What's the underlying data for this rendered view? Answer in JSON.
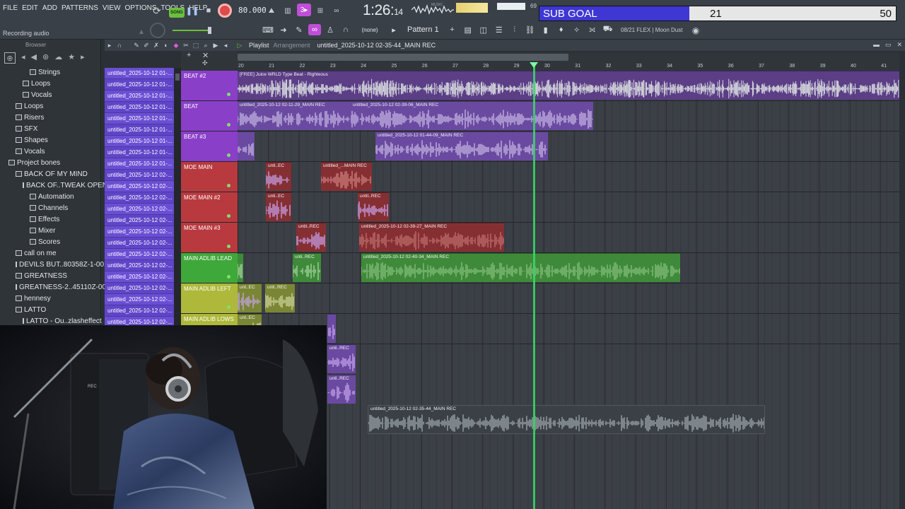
{
  "menu": [
    "FILE",
    "EDIT",
    "ADD",
    "PATTERNS",
    "VIEW",
    "OPTIONS",
    "TOOLS",
    "HELP"
  ],
  "transport": {
    "song_toggle": "SONG",
    "tempo": "80.000",
    "time_main": "1:26",
    "time_sub": "14"
  },
  "cpu_label": "MUSIC",
  "cpu_value": "69",
  "status": "Recording audio",
  "sub_goal": {
    "label": "SUB GOAL",
    "current": "21",
    "goal": "50",
    "progress": 0.42,
    "fill_color": "#3f37d3"
  },
  "toolbar2": {
    "snap": "(none)",
    "pattern": "Pattern 1",
    "hint": "08/21  FLEX | Moon Dust"
  },
  "browser": {
    "title": "Browser",
    "items": [
      {
        "label": "Strings",
        "indent": 3
      },
      {
        "label": "Loops",
        "indent": 2
      },
      {
        "label": "Vocals",
        "indent": 2
      },
      {
        "label": "Loops",
        "indent": 1
      },
      {
        "label": "Risers",
        "indent": 1
      },
      {
        "label": "SFX",
        "indent": 1
      },
      {
        "label": "Shapes",
        "indent": 1
      },
      {
        "label": "Vocals",
        "indent": 1
      },
      {
        "label": "Project bones",
        "indent": 0
      },
      {
        "label": "BACK OF MY MIND",
        "indent": 1
      },
      {
        "label": "BACK OF..TWEAK OPEN",
        "indent": 2
      },
      {
        "label": "Automation",
        "indent": 3
      },
      {
        "label": "Channels",
        "indent": 3
      },
      {
        "label": "Effects",
        "indent": 3
      },
      {
        "label": "Mixer",
        "indent": 3
      },
      {
        "label": "Scores",
        "indent": 3
      },
      {
        "label": "call on me",
        "indent": 1
      },
      {
        "label": "DEVILS BUT..80358Z-1-001",
        "indent": 1
      },
      {
        "label": "GREATNESS",
        "indent": 1
      },
      {
        "label": "GREATNESS-2..45110Z-001",
        "indent": 1
      },
      {
        "label": "hennesy",
        "indent": 1
      },
      {
        "label": "LATTO",
        "indent": 1
      },
      {
        "label": "LATTO - Ou..zlasheffect",
        "indent": 2
      }
    ]
  },
  "channels": [
    "untitled_2025-10-12 01-...",
    "untitled_2025-10-12 01-...",
    "untitled_2025-10-12 01-...",
    "untitled_2025-10-12 01-...",
    "untitled_2025-10-12 01-...",
    "untitled_2025-10-12 01-...",
    "untitled_2025-10-12 01-...",
    "untitled_2025-10-12 01-...",
    "untitled_2025-10-12 01-...",
    "untitled_2025-10-12 02-...",
    "untitled_2025-10-12 02-...",
    "untitled_2025-10-12 02-...",
    "untitled_2025-10-12 02-...",
    "untitled_2025-10-12 02-...",
    "untitled_2025-10-12 02-...",
    "untitled_2025-10-12 02-...",
    "untitled_2025-10-12 02-...",
    "untitled_2025-10-12 02-...",
    "untitled_2025-10-12 02-...",
    "untitled_2025-10-12 02-...",
    "untitled_2025-10-12 02-...",
    "untitled_2025-10-12 02-...",
    "untitled_2025-10-12 02-..."
  ],
  "playlist": {
    "title": "Playlist",
    "subtitle": "Arrangement",
    "file": "untitled_2025-10-12 02-35-44_MAIN REC",
    "bars": [
      "20",
      "21",
      "22",
      "23",
      "24",
      "25",
      "26",
      "27",
      "28",
      "29",
      "30",
      "31",
      "32",
      "33",
      "34",
      "35",
      "36",
      "37",
      "38",
      "39",
      "40",
      "41"
    ],
    "tracks": [
      {
        "name": "BEAT #2",
        "color": "#8a3fc8"
      },
      {
        "name": "BEAT",
        "color": "#8a3fc8"
      },
      {
        "name": "BEAT #3",
        "color": "#8a3fc8"
      },
      {
        "name": "MOE MAIN",
        "color": "#b83a3f"
      },
      {
        "name": "MOE MAIN #2",
        "color": "#b83a3f"
      },
      {
        "name": "MOE MAIN #3",
        "color": "#b83a3f"
      },
      {
        "name": "MAIN ADLIB LEAD",
        "color": "#3fa83a"
      },
      {
        "name": "MAIN ADLIB LEFT",
        "color": "#aeb83a"
      },
      {
        "name": "MAIN ADLIB LOWS",
        "color": "#aeb83a"
      }
    ],
    "clips": {
      "beat2": "[FREE] Juice WRLD Type Beat - Righteous",
      "beat_a": "untitled_2025-10-12 02-11-29_MAIN REC",
      "beat_b": "untitled_2025-10-12 02-39-06_MAIN REC",
      "beat3": "untitled_2025-10-12 01-44-09_MAIN REC",
      "moe_a": "unti..EC",
      "moe_b": "untitled_...MAIN REC",
      "moe2_a": "unti..EC",
      "moe2_b": "untit..REC",
      "moe3_a": "untit..REC",
      "moe3_b": "untitled_2025-10-12 02-39-27_MAIN REC",
      "lead_a": "unti..REC",
      "lead_b": "untitled_2025-10-12 02-40-34_MAIN REC",
      "left_a": "unt..EC",
      "left_b": "unti..REC",
      "low_a": "unt..EC",
      "extra_a": "unti..REC",
      "extra_b": "unti..REC",
      "main_rec": "untitled_2025-10-12 02-35-44_MAIN REC"
    }
  },
  "colors": {
    "playhead": "#37d667",
    "accent": "#c04ed8",
    "record": "#e04a4a"
  }
}
